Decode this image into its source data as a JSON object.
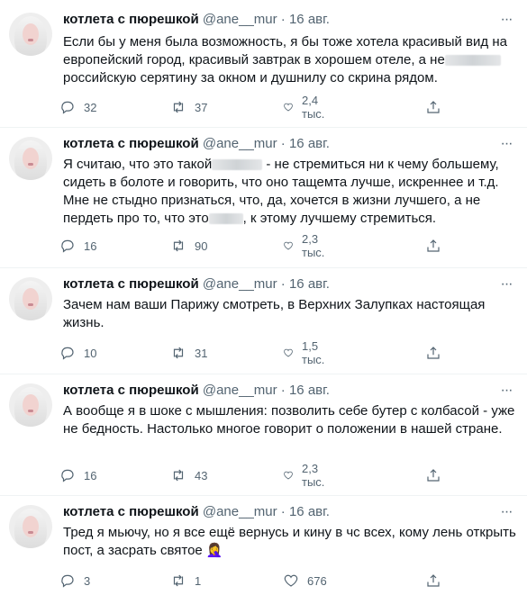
{
  "author": {
    "name": "котлета с пюрешкой",
    "handle": "@ane__mur",
    "separator": "·"
  },
  "more_glyph": "···",
  "tweets": [
    {
      "date": "16 авг.",
      "text_parts": [
        "Если бы у меня была возможность, я бы тоже хотела красивый вид на европейский город, красивый завтрак в хорошем отеле, а не",
        "российскую серятину за окном и душнилу со скрина рядом."
      ],
      "replies": "32",
      "retweets": "37",
      "likes": "2,4 тыс."
    },
    {
      "date": "16 авг.",
      "text_parts": [
        "Я считаю, что это такой",
        "- не стремиться ни к чему большему, сидеть в болоте и говорить, что оно тащемта лучше, искреннее и т.д. Мне не стыдно признаться, что, да, хочется в жизни лучшего, а не пердеть про то, что это",
        ", к этому лучшему стремиться."
      ],
      "replies": "16",
      "retweets": "90",
      "likes": "2,3 тыс."
    },
    {
      "date": "16 авг.",
      "text": "Зачем нам ваши Парижу смотреть, в Верхних Залупках настоящая жизнь.",
      "replies": "10",
      "retweets": "31",
      "likes": "1,5 тыс."
    },
    {
      "date": "16 авг.",
      "text": "А вообще я в шоке с мышления: позволить себе бутер с колбасой - уже не бедность. Настолько многое говорит о положении в нашей стране.",
      "replies": "16",
      "retweets": "43",
      "likes": "2,3 тыс."
    },
    {
      "date": "16 авг.",
      "text": "Тред я мьючу, но я все ещё вернусь и кину в чс всех, кому лень открыть пост, а засрать святое 🤦‍♀️",
      "replies": "3",
      "retweets": "1",
      "likes": "676"
    }
  ],
  "icons": [
    "reply-icon",
    "retweet-icon",
    "like-icon",
    "share-icon",
    "more-icon"
  ]
}
